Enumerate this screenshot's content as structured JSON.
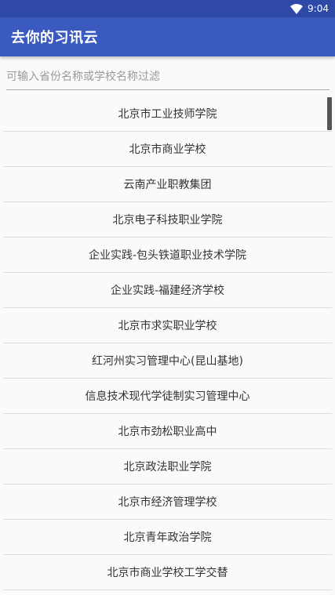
{
  "status_bar": {
    "time": "9:04",
    "wifi_icon": "wifi-icon"
  },
  "app_bar": {
    "title": "去你的习讯云"
  },
  "search": {
    "placeholder": "可输入省份名称或学校名称过滤",
    "value": ""
  },
  "schools": [
    "北京市工业技师学院",
    "北京市商业学校",
    "云南产业职教集团",
    "北京电子科技职业学院",
    "企业实践-包头铁道职业技术学院",
    "企业实践-福建经济学校",
    "北京市求实职业学校",
    "红河州实习管理中心(昆山基地)",
    "信息技术现代学徒制实习管理中心",
    "北京市劲松职业高中",
    "北京政法职业学院",
    "北京市经济管理学校",
    "北京青年政治学院",
    "北京市商业学校工学交替"
  ],
  "colors": {
    "status_bar": "#2f49a8",
    "app_bar": "#3b5ac0",
    "background": "#fafafa",
    "divider": "#dcdcdc"
  }
}
